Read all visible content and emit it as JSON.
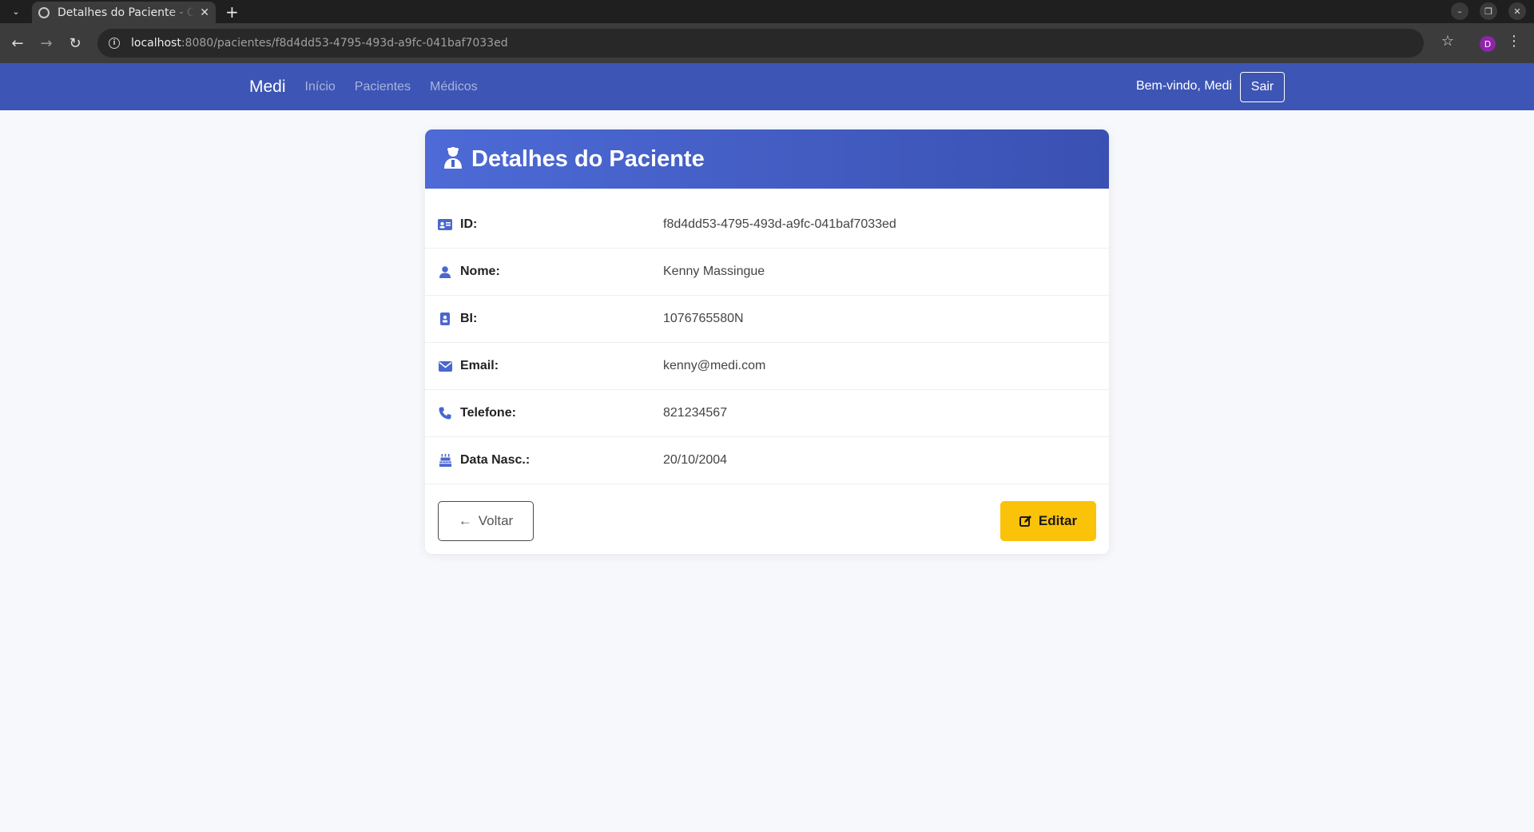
{
  "browser": {
    "tab_title": "Detalhes do Paciente - C",
    "url_host": "localhost",
    "url_rest": ":8080/pacientes/f8d4dd53-4795-493d-a9fc-041baf7033ed",
    "profile_initial": "D"
  },
  "navbar": {
    "brand": "Medi",
    "links": [
      "Início",
      "Pacientes",
      "Médicos"
    ],
    "welcome": "Bem-vindo, Medi",
    "logout": "Sair"
  },
  "card": {
    "title": "Detalhes do Paciente",
    "rows": [
      {
        "icon": "id-card-icon",
        "label": "ID:",
        "value": "f8d4dd53-4795-493d-a9fc-041baf7033ed"
      },
      {
        "icon": "user-icon",
        "label": "Nome:",
        "value": "Kenny Massingue"
      },
      {
        "icon": "id-badge-icon",
        "label": "BI:",
        "value": "1076765580N"
      },
      {
        "icon": "envelope-icon",
        "label": "Email:",
        "value": "kenny@medi.com"
      },
      {
        "icon": "phone-icon",
        "label": "Telefone:",
        "value": "821234567"
      },
      {
        "icon": "birthday-cake-icon",
        "label": "Data Nasc.:",
        "value": "20/10/2004"
      }
    ],
    "back_label": "Voltar",
    "edit_label": "Editar"
  },
  "colors": {
    "primary": "#3d55b4",
    "icon": "#4a67d0",
    "warning": "#fbc20a"
  }
}
